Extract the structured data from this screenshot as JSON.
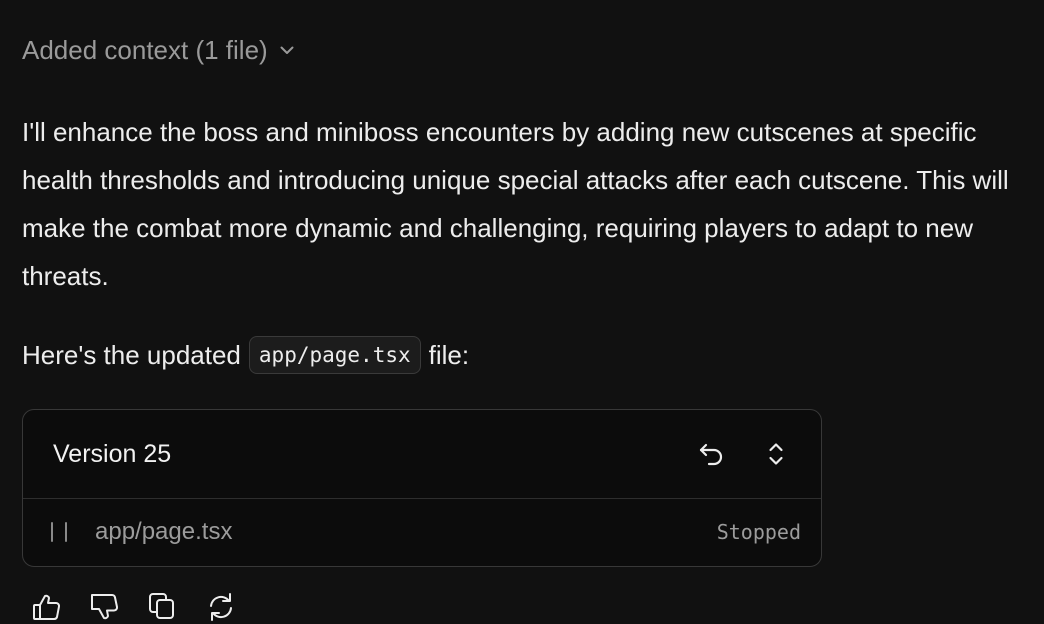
{
  "context": {
    "label": "Added context (1 file)",
    "icon": "chevron-down-icon"
  },
  "message": {
    "paragraph": "I'll enhance the boss and miniboss encounters by adding new cutscenes at specific health thresholds and introducing unique special attacks after each cutscene. This will make the combat more dynamic and challenging, requiring players to adapt to new threats.",
    "file_intro_prefix": "Here's the updated",
    "file_code": "app/page.tsx",
    "file_intro_suffix": "file:"
  },
  "version_card": {
    "title": "Version 25",
    "file_name": "app/page.tsx",
    "status": "Stopped",
    "header_icons": [
      "undo-icon",
      "expand-collapse-icon"
    ]
  },
  "feedback_icons": [
    "thumbs-up-icon",
    "thumbs-down-icon",
    "copy-icon",
    "refresh-icon"
  ],
  "colors": {
    "background": "#111111",
    "text": "#ededed",
    "muted": "#9a9a9a",
    "card_border": "#383838"
  }
}
